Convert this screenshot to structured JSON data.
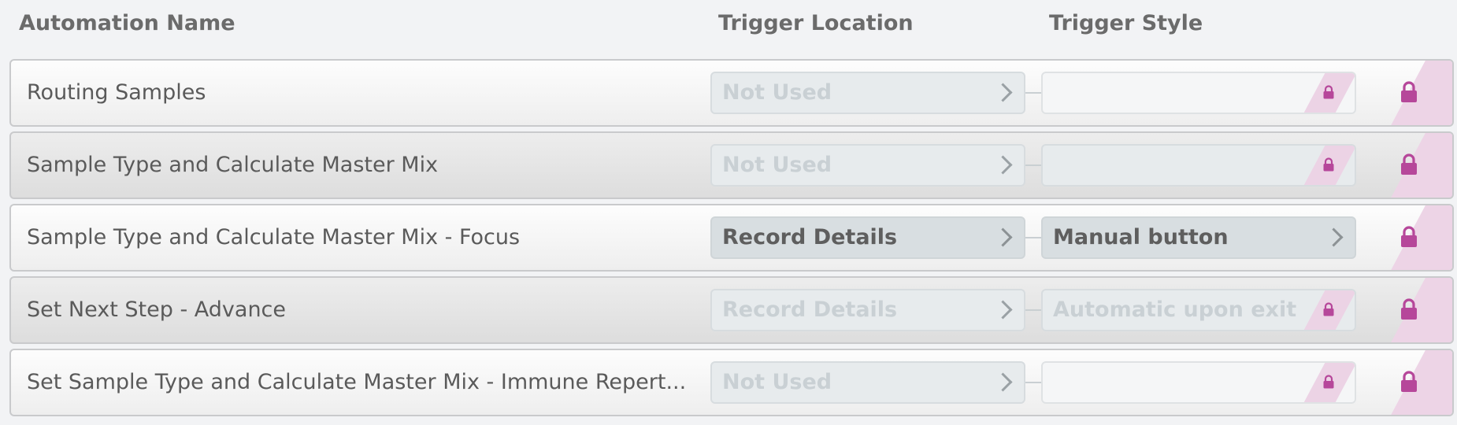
{
  "header": {
    "automation_name": "Automation Name",
    "trigger_location": "Trigger Location",
    "trigger_style": "Trigger Style"
  },
  "colors": {
    "lock_magenta": "#b6479a",
    "lock_stripe": "#ecd3e5"
  },
  "icons": {
    "chevron": "chevron-right-icon",
    "lock": "lock-icon"
  },
  "rows": [
    {
      "name": "Routing Samples",
      "location": "Not Used",
      "location_state": "disabled",
      "style": "",
      "style_state": "locked-empty"
    },
    {
      "name": "Sample Type and Calculate Master Mix",
      "location": "Not Used",
      "location_state": "disabled",
      "style": "",
      "style_state": "locked-empty"
    },
    {
      "name": "Sample Type and Calculate Master Mix - Focus",
      "location": "Record Details",
      "location_state": "enabled",
      "style": "Manual button",
      "style_state": "enabled"
    },
    {
      "name": "Set Next Step - Advance",
      "location": "Record Details",
      "location_state": "disabled",
      "style": "Automatic upon exit",
      "style_state": "locked"
    },
    {
      "name": "Set Sample Type and Calculate Master Mix - Immune Repert...",
      "location": "Not Used",
      "location_state": "disabled",
      "style": "",
      "style_state": "locked-empty"
    }
  ]
}
